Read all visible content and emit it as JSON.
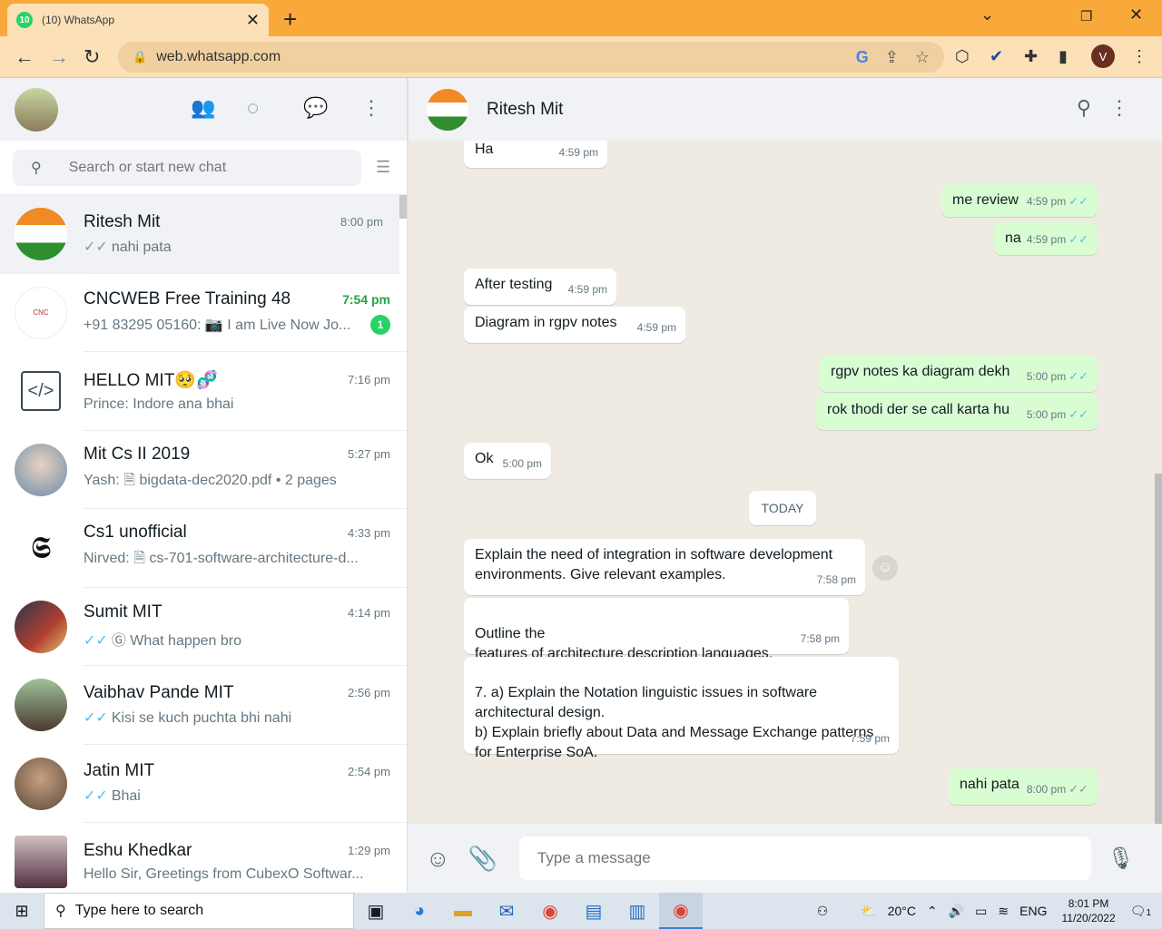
{
  "browser": {
    "tab_badge": "10",
    "tab_title": "(10) WhatsApp",
    "url": "web.whatsapp.com",
    "profile_initial": "V"
  },
  "left": {
    "search_placeholder": "Search or start new chat",
    "chats": [
      {
        "name": "Ritesh Mit",
        "time": "8:00 pm",
        "tick": "✓✓",
        "tick_color": "grey",
        "last": "nahi pata",
        "active": true
      },
      {
        "name": "CNCWEB Free Training 48",
        "time": "7:54 pm",
        "time_unread": true,
        "last": "+91 83295 05160: 📷 I am Live Now Jo...",
        "unread": "1"
      },
      {
        "name": "HELLO MIT🥺🧬",
        "time": "7:16 pm",
        "last": "Prince: Indore ana bhai"
      },
      {
        "name": "Mit Cs II 2019",
        "time": "5:27 pm",
        "last": "Yash: 🗎 bigdata-dec2020.pdf • 2 pages"
      },
      {
        "name": "Cs1 unofficial",
        "time": "4:33 pm",
        "last": "Nirved: 🗎 cs-701-software-architecture-d..."
      },
      {
        "name": "Sumit MIT",
        "time": "4:14 pm",
        "tick": "✓✓",
        "tick_color": "blue",
        "last": "Ⓖ What happen bro"
      },
      {
        "name": "Vaibhav Pande MIT",
        "time": "2:56 pm",
        "tick": "✓✓",
        "tick_color": "blue",
        "last": "Kisi se kuch puchta  bhi nahi"
      },
      {
        "name": "Jatin MIT",
        "time": "2:54 pm",
        "tick": "✓✓",
        "tick_color": "blue",
        "last": "Bhai"
      },
      {
        "name": "Eshu Khedkar",
        "time": "1:29 pm",
        "last": "Hello Sir, Greetings from CubexO Softwar..."
      }
    ]
  },
  "conversation": {
    "contact_name": "Ritesh Mit",
    "today_label": "TODAY",
    "messages": [
      {
        "dir": "in",
        "text": "Ha",
        "time": "4:59 pm"
      },
      {
        "dir": "out",
        "text": "me review",
        "time": "4:59 pm"
      },
      {
        "dir": "out",
        "text": "na",
        "time": "4:59 pm"
      },
      {
        "dir": "in",
        "text": "After testing",
        "time": "4:59 pm"
      },
      {
        "dir": "in",
        "text": "Diagram in rgpv notes",
        "time": "4:59 pm"
      },
      {
        "dir": "out",
        "text": "rgpv notes ka diagram dekh",
        "time": "5:00 pm"
      },
      {
        "dir": "out",
        "text": "rok thodi der se call karta hu",
        "time": "5:00 pm"
      },
      {
        "dir": "in",
        "text": "Ok",
        "time": "5:00 pm"
      },
      {
        "dir": "in",
        "text": "Explain the need of integration in software development environments. Give relevant examples.",
        "time": "7:58 pm"
      },
      {
        "dir": "in",
        "text": "Outline the\nfeatures of architecture description languages.",
        "time": "7:58 pm"
      },
      {
        "dir": "in",
        "text": "7. a) Explain the Notation linguistic issues in software architectural design.\nb) Explain briefly about Data and Message Exchange patterns for Enterprise SoA.",
        "time": "7:59 pm"
      },
      {
        "dir": "out",
        "text": "nahi pata",
        "time": "8:00 pm"
      }
    ],
    "composer_placeholder": "Type a message"
  },
  "taskbar": {
    "search_text": "Type here to search",
    "weather": "20°C",
    "language": "ENG",
    "time": "8:01 PM",
    "date": "11/20/2022",
    "notifications": "1"
  }
}
